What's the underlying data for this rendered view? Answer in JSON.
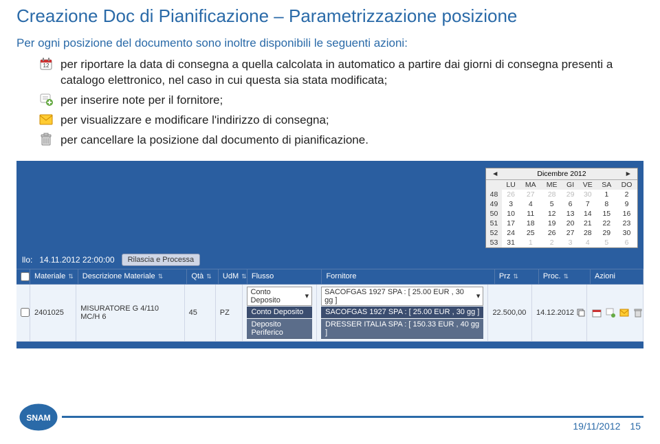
{
  "title": "Creazione Doc di Pianificazione – Parametrizzazione posizione",
  "intro": "Per ogni posizione del documento sono inoltre disponibili le seguenti azioni:",
  "actions": [
    "per riportare la data di consegna a quella calcolata in automatico a partire dai giorni di consegna presenti a catalogo elettronico, nel caso in cui questa sia stata modificata;",
    "per inserire note per il fornitore;",
    "per visualizzare e modificare l'indirizzo di consegna;",
    "per cancellare la posizione dal documento di pianificazione."
  ],
  "info": {
    "lloLabel": "llo:",
    "lloValue": "14.11.2012 22:00:00",
    "rpButton": "Rilascia e Processa"
  },
  "calendar": {
    "monthLabel": "Dicembre 2012",
    "days": [
      "LU",
      "MA",
      "ME",
      "GI",
      "VE",
      "SA",
      "DO"
    ],
    "weeks": [
      {
        "wk": "48",
        "cells": [
          {
            "v": "26",
            "dim": true
          },
          {
            "v": "27",
            "dim": true
          },
          {
            "v": "28",
            "dim": true
          },
          {
            "v": "29",
            "dim": true
          },
          {
            "v": "30",
            "dim": true
          },
          {
            "v": "1"
          },
          {
            "v": "2"
          }
        ]
      },
      {
        "wk": "49",
        "cells": [
          {
            "v": "3"
          },
          {
            "v": "4"
          },
          {
            "v": "5"
          },
          {
            "v": "6"
          },
          {
            "v": "7"
          },
          {
            "v": "8"
          },
          {
            "v": "9"
          }
        ]
      },
      {
        "wk": "50",
        "cells": [
          {
            "v": "10"
          },
          {
            "v": "11"
          },
          {
            "v": "12"
          },
          {
            "v": "13"
          },
          {
            "v": "14"
          },
          {
            "v": "15"
          },
          {
            "v": "16"
          }
        ]
      },
      {
        "wk": "51",
        "cells": [
          {
            "v": "17"
          },
          {
            "v": "18"
          },
          {
            "v": "19"
          },
          {
            "v": "20"
          },
          {
            "v": "21"
          },
          {
            "v": "22"
          },
          {
            "v": "23"
          }
        ]
      },
      {
        "wk": "52",
        "cells": [
          {
            "v": "24"
          },
          {
            "v": "25"
          },
          {
            "v": "26"
          },
          {
            "v": "27"
          },
          {
            "v": "28"
          },
          {
            "v": "29"
          },
          {
            "v": "30"
          }
        ]
      },
      {
        "wk": "53",
        "cells": [
          {
            "v": "31"
          },
          {
            "v": "1",
            "dim": true
          },
          {
            "v": "2",
            "dim": true
          },
          {
            "v": "3",
            "dim": true
          },
          {
            "v": "4",
            "dim": true
          },
          {
            "v": "5",
            "dim": true
          },
          {
            "v": "6",
            "dim": true
          }
        ]
      }
    ]
  },
  "table": {
    "headers": {
      "materiale": "Materiale",
      "descrizione": "Descrizione Materiale",
      "qta": "Qtà",
      "udm": "UdM",
      "flusso": "Flusso",
      "fornitore": "Fornitore",
      "prz": "Prz",
      "proc": "Proc.",
      "azioni": "Azioni"
    },
    "row": {
      "materiale": "2401025",
      "descrizione": "MISURATORE G 4/110 MC/H 6",
      "qta": "45",
      "udm": "PZ",
      "flusso": "Conto Deposito",
      "fornitore": "SACOFGAS 1927 SPA : [ 25.00 EUR , 30 gg ]",
      "prz": "22.500,00",
      "proc": "14.12.2012"
    },
    "flussoOptions": [
      "Conto Deposito",
      "Deposito Periferico"
    ],
    "fornitoreOptions": [
      "SACOFGAS 1927 SPA : [ 25.00 EUR , 30 gg ]",
      "DRESSER ITALIA SPA : [ 150.33 EUR , 40 gg ]"
    ]
  },
  "footer": {
    "date": "19/11/2012",
    "page": "15"
  }
}
